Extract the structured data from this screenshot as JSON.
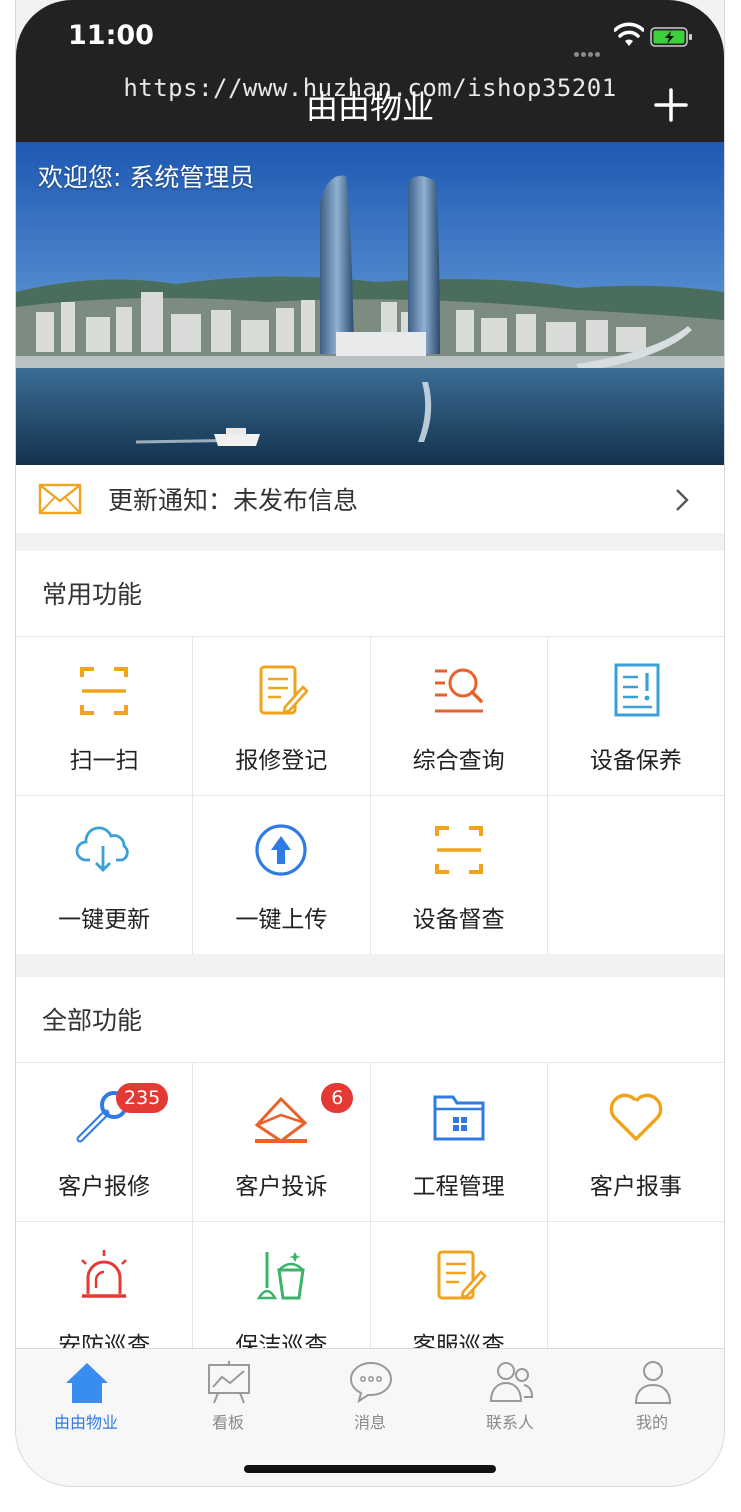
{
  "status_bar": {
    "time": "11:00"
  },
  "header": {
    "watermark": "https://www.huzhan.com/ishop35201",
    "title": "由由物业"
  },
  "banner": {
    "welcome": "欢迎您: 系统管理员"
  },
  "notice": {
    "text": "更新通知：未发布信息"
  },
  "common": {
    "title": "常用功能",
    "items": [
      {
        "label": "扫一扫",
        "icon": "scan-icon"
      },
      {
        "label": "报修登记",
        "icon": "edit-form-icon"
      },
      {
        "label": "综合查询",
        "icon": "search-list-icon"
      },
      {
        "label": "设备保养",
        "icon": "device-report-icon"
      },
      {
        "label": "一键更新",
        "icon": "cloud-download-icon"
      },
      {
        "label": "一键上传",
        "icon": "upload-icon"
      },
      {
        "label": "设备督查",
        "icon": "scan-icon"
      }
    ]
  },
  "all": {
    "title": "全部功能",
    "items": [
      {
        "label": "客户报修",
        "icon": "wrench-icon",
        "badge": "235"
      },
      {
        "label": "客户投诉",
        "icon": "complaint-envelope-icon",
        "badge": "6"
      },
      {
        "label": "工程管理",
        "icon": "folder-icon"
      },
      {
        "label": "客户报事",
        "icon": "heart-icon"
      },
      {
        "label": "安防巡查",
        "icon": "alarm-light-icon"
      },
      {
        "label": "保洁巡查",
        "icon": "cleaning-bucket-icon"
      },
      {
        "label": "客服巡查",
        "icon": "edit-form-icon"
      }
    ]
  },
  "tabs": [
    {
      "label": "由由物业",
      "icon": "home-icon",
      "active": true
    },
    {
      "label": "看板",
      "icon": "dashboard-icon"
    },
    {
      "label": "消息",
      "icon": "chat-icon"
    },
    {
      "label": "联系人",
      "icon": "contacts-icon"
    },
    {
      "label": "我的",
      "icon": "profile-icon"
    }
  ],
  "colors": {
    "orange": "#f0a31c",
    "orange_red": "#e9622b",
    "blue": "#2f7be5",
    "teal": "#3aa0d8",
    "red": "#e53935",
    "green": "#3db36a"
  }
}
